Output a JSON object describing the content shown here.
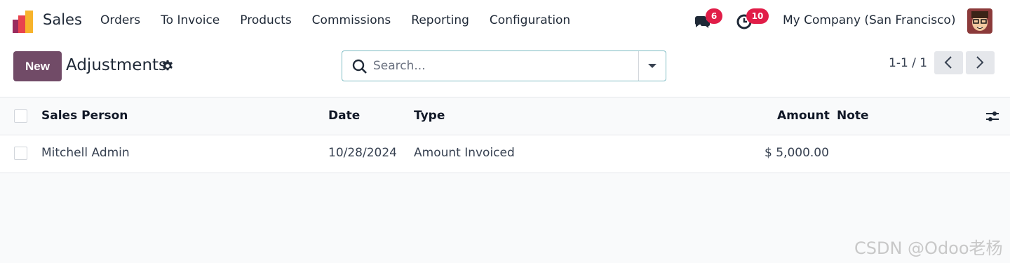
{
  "navbar": {
    "app_name": "Sales",
    "menu": [
      "Orders",
      "To Invoice",
      "Products",
      "Commissions",
      "Reporting",
      "Configuration"
    ],
    "messages_count": "6",
    "activities_count": "10",
    "company": "My Company (San Francisco)"
  },
  "control": {
    "new_label": "New",
    "title": "Adjustments",
    "search_placeholder": "Search...",
    "pager": "1-1 / 1"
  },
  "table": {
    "columns": [
      "Sales Person",
      "Date",
      "Type",
      "Amount",
      "Note"
    ],
    "rows": [
      {
        "sales_person": "Mitchell Admin",
        "date": "10/28/2024",
        "type": "Amount Invoiced",
        "amount": "$ 5,000.00",
        "note": ""
      }
    ]
  },
  "watermark": "CSDN @Odoo老杨",
  "colors": {
    "brand": "#714b67",
    "badge": "#e11d48",
    "search_border": "#7fbdc4"
  }
}
